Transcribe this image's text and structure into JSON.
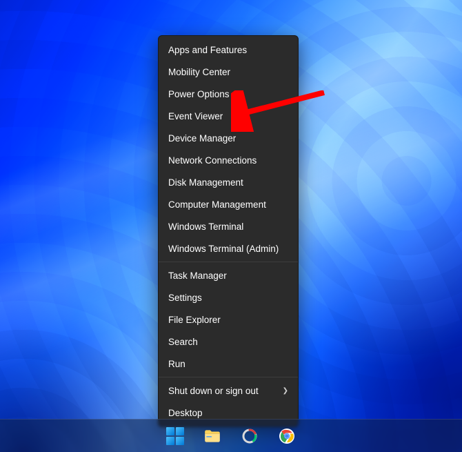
{
  "context_menu": {
    "groups": [
      [
        "Apps and Features",
        "Mobility Center",
        "Power Options",
        "Event Viewer",
        "Device Manager",
        "Network Connections",
        "Disk Management",
        "Computer Management",
        "Windows Terminal",
        "Windows Terminal (Admin)"
      ],
      [
        "Task Manager",
        "Settings",
        "File Explorer",
        "Search",
        "Run"
      ],
      [
        "Shut down or sign out",
        "Desktop"
      ]
    ],
    "submenu_items": [
      "Shut down or sign out"
    ],
    "highlighted": "Event Viewer"
  },
  "taskbar": {
    "icons": [
      "start",
      "file-explorer",
      "settings",
      "chrome"
    ]
  }
}
